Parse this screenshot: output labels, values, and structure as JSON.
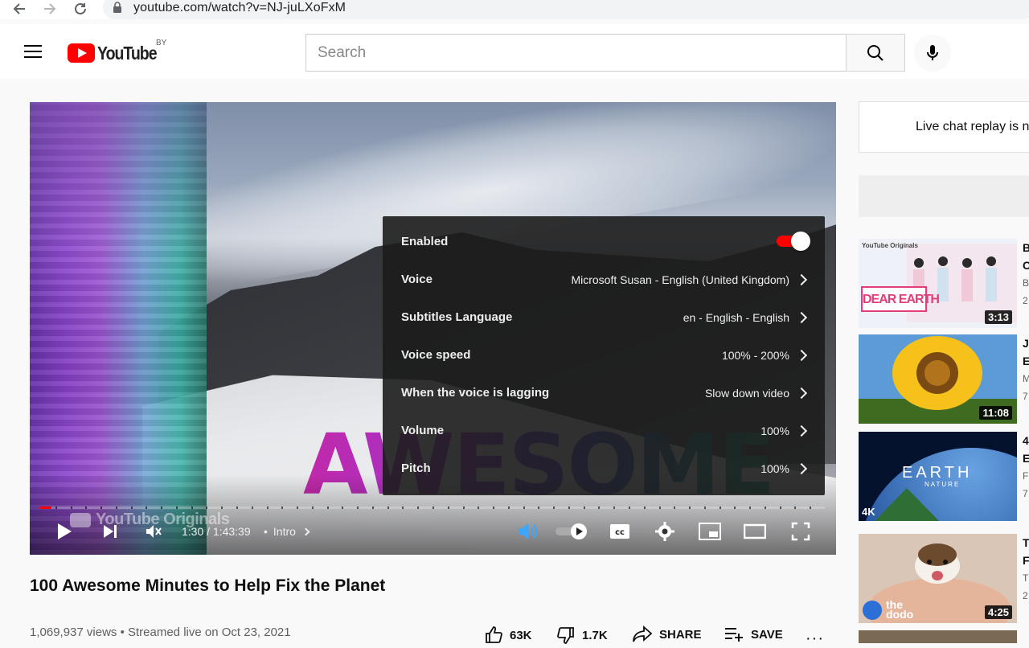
{
  "browser": {
    "url": "youtube.com/watch?v=NJ-juLXoFxM"
  },
  "masthead": {
    "logo_text": "YouTube",
    "country_code": "BY",
    "search_placeholder": "Search"
  },
  "player": {
    "watermark": "YouTube Originals",
    "overlay_title_text": "AWESOME",
    "time_display": "1:30 / 1:43:39",
    "chapter": "Intro",
    "progress_fraction": 0.0145,
    "settings": [
      {
        "label": "Enabled",
        "value": "",
        "type": "toggle",
        "on": true
      },
      {
        "label": "Voice",
        "value": "Microsoft Susan - English (United Kingdom)",
        "type": "menu"
      },
      {
        "label": "Subtitles Language",
        "value": "en - English - English",
        "type": "menu"
      },
      {
        "label": "Voice speed",
        "value": "100% - 200%",
        "type": "menu"
      },
      {
        "label": "When the voice is lagging",
        "value": "Slow down video",
        "type": "menu"
      },
      {
        "label": "Volume",
        "value": "100%",
        "type": "menu"
      },
      {
        "label": "Pitch",
        "value": "100%",
        "type": "menu"
      }
    ],
    "accent_color": "#ff0000",
    "voice_icon_color": "#3ea6ff"
  },
  "video": {
    "title": "100 Awesome Minutes to Help Fix the Planet",
    "meta": "1,069,937 views • Streamed live on Oct 23, 2021",
    "like_count": "63K",
    "dislike_count": "1.7K",
    "share_label": "SHARE",
    "save_label": "SAVE"
  },
  "sidebar": {
    "chat_text": "Live chat replay is n",
    "recommendations": [
      {
        "duration": "3:13",
        "thumb_text": "DEAR EARTH",
        "channel_badge": "YouTube Originals",
        "side_lines": [
          "B",
          "C",
          "B",
          "2"
        ]
      },
      {
        "duration": "11:08",
        "side_lines": [
          "J",
          "E",
          "M",
          "7"
        ]
      },
      {
        "duration": "",
        "thumb_text": "EARTH",
        "thumb_subtext": "NATURE",
        "badge": "4K",
        "side_lines": [
          "4",
          "E",
          "F",
          "7"
        ]
      },
      {
        "duration": "4:25",
        "thumb_text": "the dodo",
        "side_lines": [
          "T",
          "F",
          "T",
          "2"
        ]
      }
    ]
  }
}
